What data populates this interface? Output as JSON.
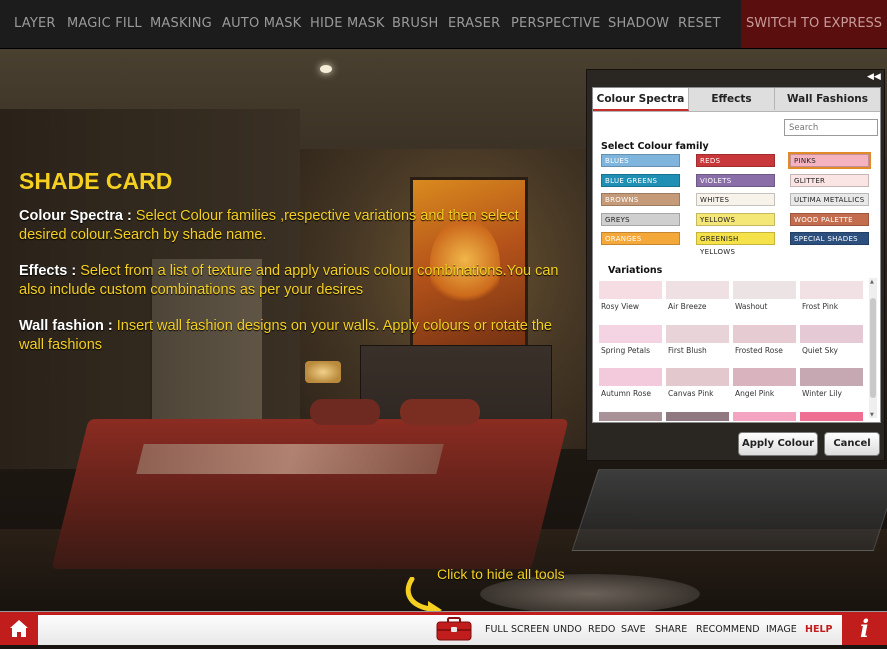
{
  "toolbar": {
    "items": [
      "LAYER",
      "MAGIC FILL",
      "MASKING",
      "AUTO MASK",
      "HIDE MASK",
      "BRUSH",
      "ERASER",
      "PERSPECTIVE",
      "SHADOW",
      "RESET"
    ],
    "express_label": "SWITCH TO EXPRESS"
  },
  "shade_card": {
    "title": "SHADE CARD",
    "colour_spectra_label": "Colour Spectra :",
    "colour_spectra_text": "Select Colour families ,respective variations and then select desired colour.Search by shade name.",
    "effects_label": "Effects :",
    "effects_text": "Select from a list of texture and apply various colour combinations.You can also include custom combinations as per your desires",
    "wall_fashion_label": "Wall fashion :",
    "wall_fashion_text": "Insert wall fashion designs on your walls. Apply colours or rotate the wall fashions"
  },
  "panel": {
    "collapse_icon": "double-left-chevron-icon",
    "tabs": [
      {
        "label": "Colour Spectra",
        "active": true
      },
      {
        "label": "Effects",
        "active": false
      },
      {
        "label": "Wall Fashions",
        "active": false
      }
    ],
    "search_placeholder": "Search",
    "family_title": "Select Colour family",
    "families": [
      {
        "label": "BLUES",
        "color": "#7fb5dc"
      },
      {
        "label": "REDS",
        "color": "#c8383a"
      },
      {
        "label": "PINKS",
        "color": "#f5b3bf",
        "selected": true
      },
      {
        "label": "BLUE GREENS",
        "color": "#1f8fb3"
      },
      {
        "label": "VIOLETS",
        "color": "#8a6ea8"
      },
      {
        "label": "GLITTER",
        "color": "#fbe4e4"
      },
      {
        "label": "BROWNS",
        "color": "#c49a78"
      },
      {
        "label": "WHITES",
        "color": "#f7f3ea"
      },
      {
        "label": "ULTIMA METALLICS",
        "color": "#e8e8e8"
      },
      {
        "label": "GREYS",
        "color": "#cfcfcf"
      },
      {
        "label": "YELLOWS",
        "color": "#f5e678"
      },
      {
        "label": "WOOD PALETTE",
        "color": "#c36d4e"
      },
      {
        "label": "ORANGES",
        "color": "#f5a83a"
      },
      {
        "label": "GREENISH YELLOWS",
        "color": "#f5e24a"
      },
      {
        "label": "SPECIAL SHADES",
        "color": "#2d4f7e"
      }
    ],
    "variations_title": "Variations",
    "variations": [
      {
        "name": "Rosy View",
        "color": "#f5dde3"
      },
      {
        "name": "Air Breeze",
        "color": "#eee0e3"
      },
      {
        "name": "Washout",
        "color": "#ece4e4"
      },
      {
        "name": "Frost Pink",
        "color": "#f1e0e4"
      },
      {
        "name": "Spring Petals",
        "color": "#f4d4e2"
      },
      {
        "name": "First Blush",
        "color": "#e8d4d8"
      },
      {
        "name": "Frosted Rose",
        "color": "#e6ccd2"
      },
      {
        "name": "Quiet Sky",
        "color": "#e5cad6"
      },
      {
        "name": "Autumn Rose",
        "color": "#f3cadb"
      },
      {
        "name": "Canvas Pink",
        "color": "#e3c8ce"
      },
      {
        "name": "Angel Pink",
        "color": "#d9b4be"
      },
      {
        "name": "Winter Lily",
        "color": "#c6a8b2"
      },
      {
        "name": "",
        "color": "#a89298"
      },
      {
        "name": "",
        "color": "#8f7880"
      },
      {
        "name": "",
        "color": "#f4a3c0"
      },
      {
        "name": "",
        "color": "#ee6f91"
      }
    ],
    "apply_label": "Apply Colour",
    "cancel_label": "Cancel"
  },
  "hint": {
    "text": "Click to hide all tools"
  },
  "bottom": {
    "home_icon": "home-icon",
    "toolbox_icon": "toolbox-icon",
    "links": [
      "FULL SCREEN",
      "UNDO",
      "REDO",
      "SAVE",
      "SHARE",
      "RECOMMEND",
      "IMAGE"
    ],
    "help_label": "HELP",
    "info_label": "i"
  },
  "colors": {
    "accent_red": "#c21d1d",
    "highlight_yellow": "#f5d020"
  }
}
